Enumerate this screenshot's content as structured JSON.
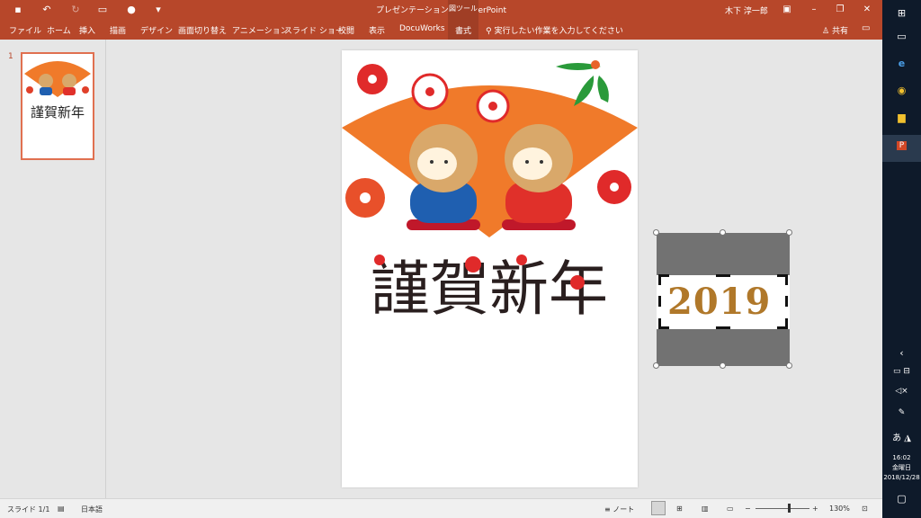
{
  "titlebar": {
    "title": "プレゼンテーション1  -  PowerPoint",
    "tools_tab": "図ツール",
    "user": "木下 淳一郎"
  },
  "ribbon": {
    "tabs": [
      "ファイル",
      "ホーム",
      "挿入",
      "描画",
      "デザイン",
      "画面切り替え",
      "アニメーション",
      "スライド ショー",
      "校閲",
      "表示",
      "DocuWorks",
      "書式"
    ],
    "active_tab": "書式",
    "tell_me": "実行したい作業を入力してください",
    "share": "共有"
  },
  "thumbnails": {
    "number": "1",
    "text": "謹賀新年"
  },
  "slide": {
    "greeting": "謹賀新年"
  },
  "selected_image": {
    "year": "2019"
  },
  "status": {
    "slide": "スライド 1/1",
    "language": "日本語",
    "notes": "ノート",
    "zoom": "130%",
    "zoom_level": 0.62
  },
  "taskbar": {
    "ime": "あ",
    "time": "16:02",
    "day": "金曜日",
    "date": "2018/12/28"
  },
  "colors": {
    "accent": "#b7472a",
    "fan": "#f07a2a",
    "plum": "#e02a2a"
  }
}
